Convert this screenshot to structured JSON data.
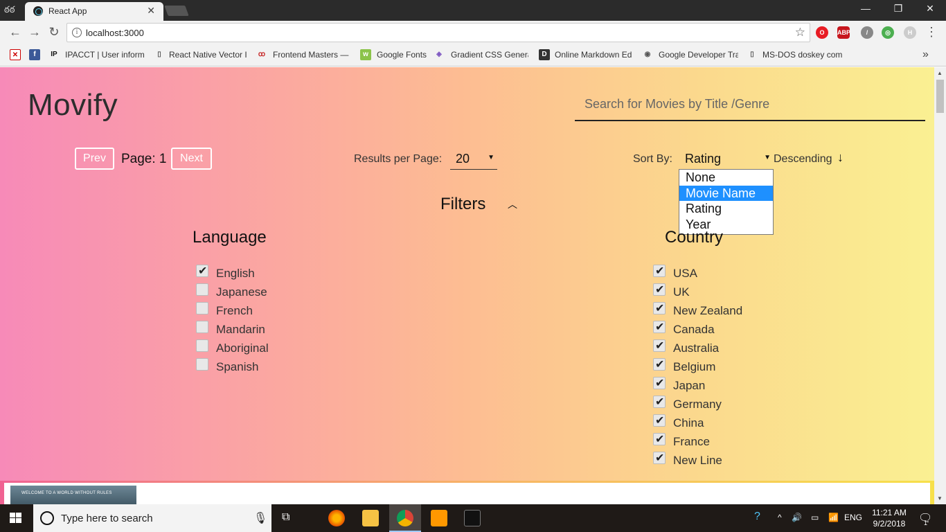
{
  "browser": {
    "tab_title": "React App",
    "tab_close": "✕",
    "url": "localhost:3000",
    "window_controls": [
      "—",
      "❐",
      "✕"
    ],
    "bookmarks": [
      {
        "icon": "pdf-icon",
        "label": ""
      },
      {
        "icon": "facebook-icon",
        "label": ""
      },
      {
        "icon": "ipacct-icon",
        "label": "IPACCT | User informa"
      },
      {
        "icon": "page-icon",
        "label": "React Native Vector Ic"
      },
      {
        "icon": "frontend-masters-icon",
        "label": "Frontend Masters —"
      },
      {
        "icon": "google-fonts-icon",
        "label": "Google Fonts"
      },
      {
        "icon": "gradient-icon",
        "label": "Gradient CSS Generat"
      },
      {
        "icon": "d-icon",
        "label": "Online Markdown Edi"
      },
      {
        "icon": "google-dev-icon",
        "label": "Google Developer Tra"
      },
      {
        "icon": "page-icon",
        "label": "MS-DOS doskey com"
      }
    ],
    "bookmarks_more": "»"
  },
  "app": {
    "brand": "Movify",
    "search_placeholder": "Search for Movies by Title /Genre",
    "pagination": {
      "prev": "Prev",
      "page_label": "Page: 1",
      "next": "Next"
    },
    "results_per_page": {
      "label": "Results per Page:",
      "value": "20"
    },
    "sort": {
      "label": "Sort By:",
      "value": "Rating",
      "direction": "Descending",
      "direction_arrow": "🡓",
      "options": [
        "None",
        "Movie Name",
        "Rating",
        "Year"
      ],
      "highlighted": "Movie Name"
    },
    "filters": {
      "title": "Filters",
      "toggle": "^",
      "language": {
        "title": "Language",
        "items": [
          {
            "label": "English",
            "checked": true
          },
          {
            "label": "Japanese",
            "checked": false
          },
          {
            "label": "French",
            "checked": false
          },
          {
            "label": "Mandarin",
            "checked": false
          },
          {
            "label": "Aboriginal",
            "checked": false
          },
          {
            "label": "Spanish",
            "checked": false
          }
        ]
      },
      "country": {
        "title": "Country",
        "items": [
          {
            "label": "USA",
            "checked": true
          },
          {
            "label": "UK",
            "checked": true
          },
          {
            "label": "New Zealand",
            "checked": true
          },
          {
            "label": "Canada",
            "checked": true
          },
          {
            "label": "Australia",
            "checked": true
          },
          {
            "label": "Belgium",
            "checked": true
          },
          {
            "label": "Japan",
            "checked": true
          },
          {
            "label": "Germany",
            "checked": true
          },
          {
            "label": "China",
            "checked": true
          },
          {
            "label": "France",
            "checked": true
          },
          {
            "label": "New Line",
            "checked": true
          }
        ]
      }
    },
    "poster_tagline": "WELCOME TO A WORLD WITHOUT RULES"
  },
  "taskbar": {
    "search_text": "Type here to search",
    "language": "ENG",
    "time": "11:21 AM",
    "date": "9/2/2018",
    "notifications": "1"
  },
  "colors": {
    "gradient_start": "#f78ab8",
    "gradient_end": "#faf092",
    "dropdown_highlight": "#1e90ff"
  }
}
